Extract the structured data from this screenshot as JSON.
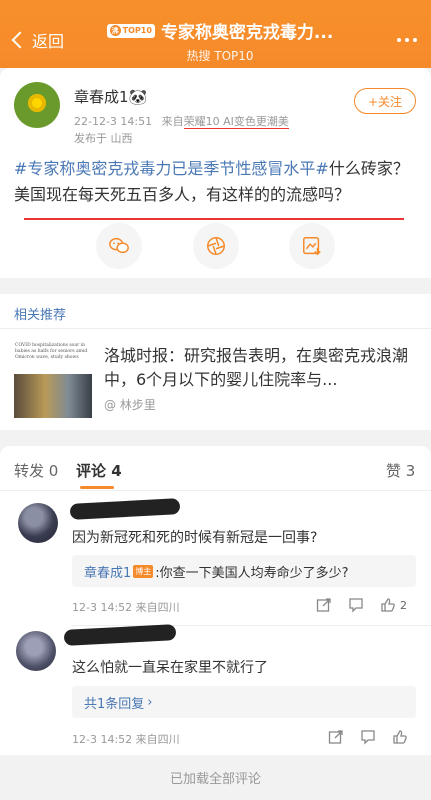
{
  "header": {
    "back_label": "返回",
    "badge_text": "TOP10",
    "badge_hot": "沸",
    "title": "专家称奥密克戎毒力...",
    "subtitle": "热搜 TOP10"
  },
  "post": {
    "username": "章春成1🐼",
    "time": "22-12-3 14:51",
    "source_prefix": "来自",
    "device": "荣耀10 AI变色更潮美",
    "published_from": "发布于 山西",
    "follow_label": "+关注",
    "topic": "#专家称奥密克戎毒力已是季节性感冒水平#",
    "body": "什么砖家？美国现在每天死五百多人，有这样的的流感吗？"
  },
  "related": {
    "header": "相关推荐",
    "thumb_text": "COVID hospitalizations soar in babies as halfs for seniors amid Omicron wave, study shows",
    "title": "洛城时报：研究报告表明，在奥密克戎浪潮中，6个月以下的婴儿住院率与...",
    "author": "@ 林步里"
  },
  "tabs": {
    "repost": "转发 0",
    "comment": "评论 4",
    "like": "赞 3"
  },
  "comments": [
    {
      "text": "因为新冠死和死的时候有新冠是一回事?",
      "reply_name": "章春成1",
      "reply_badge": "博主",
      "reply_text": ":你查一下美国人均寿命少了多少?",
      "meta": "12-3 14:52  来自四川",
      "likes": "2"
    },
    {
      "text": "这么怕就一直呆在家里不就行了",
      "reply_summary": "共1条回复",
      "meta": "12-3 14:52  来自四川",
      "likes": ""
    }
  ],
  "footer": {
    "text": "已加载全部评论"
  },
  "colors": {
    "brand": "#f58a2b",
    "link": "#4a78b5",
    "annotation_red": "#e33333"
  }
}
